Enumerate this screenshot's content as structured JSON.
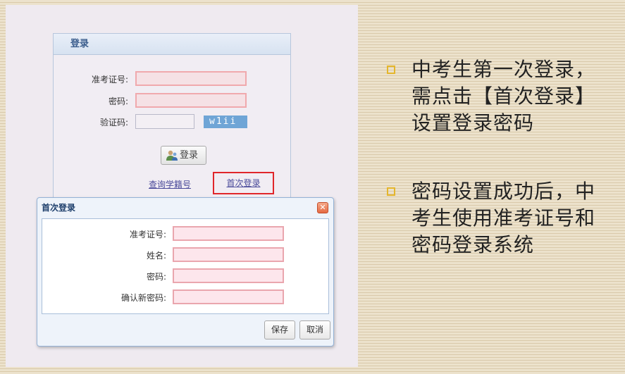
{
  "login": {
    "title": "登录",
    "exam_id_label": "准考证号:",
    "password_label": "密码:",
    "captcha_label": "验证码:",
    "captcha_text": "w1ii",
    "login_button": "登录",
    "query_link": "查询学籍号",
    "first_login_link": "首次登录"
  },
  "dialog": {
    "title": "首次登录",
    "close_glyph": "✕",
    "exam_id_label": "准考证号:",
    "name_label": "姓名:",
    "password_label": "密码:",
    "confirm_label": "确认新密码:",
    "save_button": "保存",
    "cancel_button": "取消"
  },
  "bullets": [
    {
      "lines": [
        "中考生第一次登录，",
        "需点击【首次登录】",
        "设置登录密码"
      ]
    },
    {
      "lines": [
        "密码设置成功后，中",
        "考生使用准考证号和",
        "密码登录系统"
      ]
    }
  ],
  "colors": {
    "bullet_marker": "#e4b62c",
    "highlight_box": "#e0262a",
    "link": "#4a4a9a"
  }
}
